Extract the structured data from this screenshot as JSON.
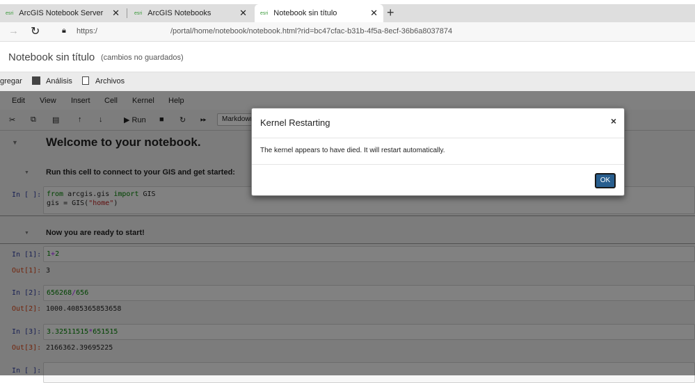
{
  "browser": {
    "tabs": [
      {
        "label": "ArcGIS Notebook Server"
      },
      {
        "label": "ArcGIS Notebooks"
      },
      {
        "label": "Notebook sin título"
      }
    ],
    "url_prefix": "https:/",
    "url_path": "/portal/home/notebook/notebook.html?rid=bc47cfac-b31b-4f5a-8ecf-36b6a8037874"
  },
  "header": {
    "title": "Notebook sin título",
    "status": "(cambios no guardados)"
  },
  "app_toolbar": {
    "add": "gregar",
    "analysis": "Análisis",
    "files": "Archivos"
  },
  "menu": [
    "Edit",
    "View",
    "Insert",
    "Cell",
    "Kernel",
    "Help"
  ],
  "toolbar": {
    "run": "Run",
    "cell_type": "Markdown"
  },
  "cells": {
    "h1": "Welcome to your notebook.",
    "h3a": "Run this cell to connect to your GIS and get started:",
    "h3b": "Now you are ready to start!",
    "p0": "In [ ]:",
    "c0a_kw1": "from",
    "c0a_mid": " arcgis.gis ",
    "c0a_kw2": "import",
    "c0a_end": " GIS",
    "c0b_pre": "gis = GIS(",
    "c0b_str": "\"home\"",
    "c0b_end": ")",
    "p1": "In [1]:",
    "o1": "Out[1]:",
    "v1": "3",
    "c1a": "1",
    "c1op": "+",
    "c1b": "2",
    "p2": "In [2]:",
    "o2": "Out[2]:",
    "v2": "1000.4085365853658",
    "c2a": "656268",
    "c2op": "/",
    "c2b": "656",
    "p3": "In [3]:",
    "o3": "Out[3]:",
    "v3": "2166362.39695225",
    "c3a": "3.32511515",
    "c3op": "*",
    "c3b": "651515",
    "p4": "In [ ]:"
  },
  "dialog": {
    "title": "Kernel Restarting",
    "message": "The kernel appears to have died. It will restart automatically.",
    "ok": "OK",
    "close": "×"
  }
}
